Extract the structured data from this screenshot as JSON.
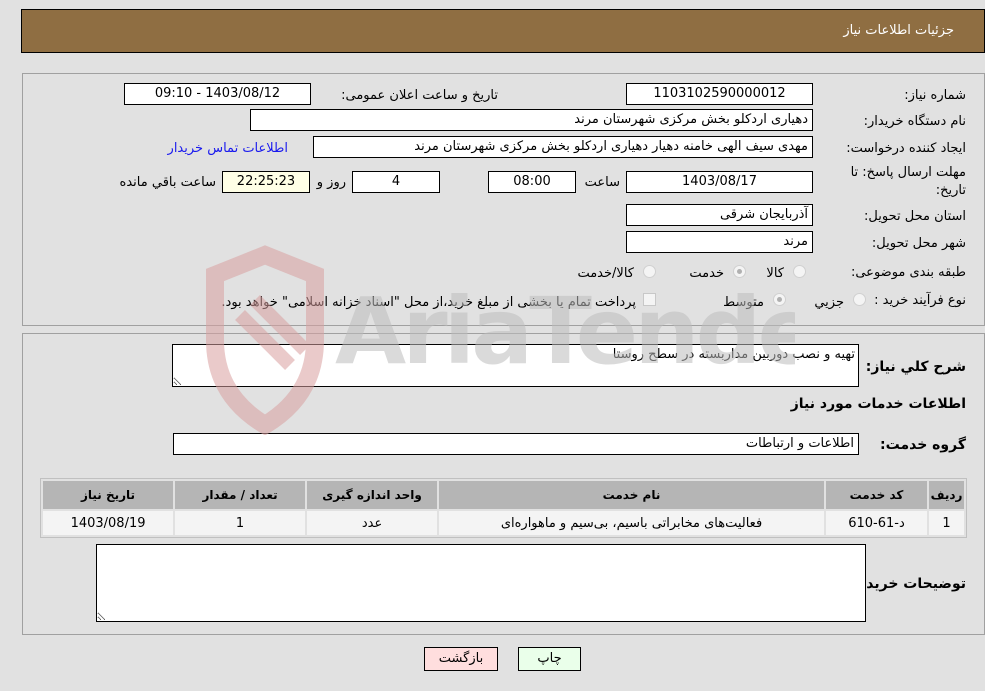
{
  "header": {
    "title": "جزئیات اطلاعات نیاز"
  },
  "details": {
    "need_number": {
      "label": "شماره نیاز:",
      "value": "1103102590000012"
    },
    "announce_datetime": {
      "label": "تاریخ و ساعت اعلان عمومی:",
      "value": "1403/08/12 - 09:10"
    },
    "buyer_org": {
      "label": "نام دستگاه خریدار:",
      "value": "دهیاری اردکلو بخش مرکزی شهرستان مرند"
    },
    "requester": {
      "label": "ایجاد کننده درخواست:",
      "value": "مهدی سیف الهی خامنه دهیار دهیاری اردکلو بخش مرکزی شهرستان مرند"
    },
    "buyer_contact_link": "اطلاعات تماس خریدار",
    "deadline": {
      "label": "مهلت ارسال پاسخ: تا تاریخ:",
      "date": "1403/08/17",
      "time_label": "ساعت",
      "time": "08:00",
      "days": "4",
      "days_label": "روز و",
      "remaining": "22:25:23",
      "remaining_label": "ساعت باقي مانده"
    },
    "province": {
      "label": "استان محل تحویل:",
      "value": "آذربایجان شرقی"
    },
    "city": {
      "label": "شهر محل تحویل:",
      "value": "مرند"
    },
    "category": {
      "label": "طبقه بندی موضوعی:",
      "options": [
        "کالا",
        "خدمت",
        "کالا/خدمت"
      ],
      "selected": "خدمت"
    },
    "purchase_type": {
      "label": "نوع فرآیند خرید :",
      "options": [
        "جزيي",
        "متوسط"
      ],
      "selected": "متوسط",
      "treasury_note": "پرداخت تمام یا بخشی از مبلغ خرید،از محل \"اسناد خزانه اسلامی\" خواهد بود."
    }
  },
  "needs": {
    "description_label": "شرح کلي نياز:",
    "description_value": "تهیه و نصب دوربین مداربسته در سطح روستا",
    "services_title": "اطلاعات خدمات مورد نياز",
    "service_group_label": "گروه خدمت:",
    "service_group_value": "اطلاعات و ارتباطات",
    "table": {
      "headers": [
        "ردیف",
        "کد خدمت",
        "نام خدمت",
        "واحد اندازه گیری",
        "تعداد / مقدار",
        "تاریخ نیاز"
      ],
      "rows": [
        [
          "1",
          "د-61-610",
          "فعالیت‌های مخابراتی باسیم، بی‌سیم و ماهواره‌ای",
          "عدد",
          "1",
          "1403/08/19"
        ]
      ]
    },
    "buyer_notes_label": "توضیحات خریدار:",
    "buyer_notes_value": ""
  },
  "buttons": {
    "print": "چاپ",
    "back": "بازگشت"
  },
  "watermark": {
    "text": "AriaTender.neT"
  }
}
